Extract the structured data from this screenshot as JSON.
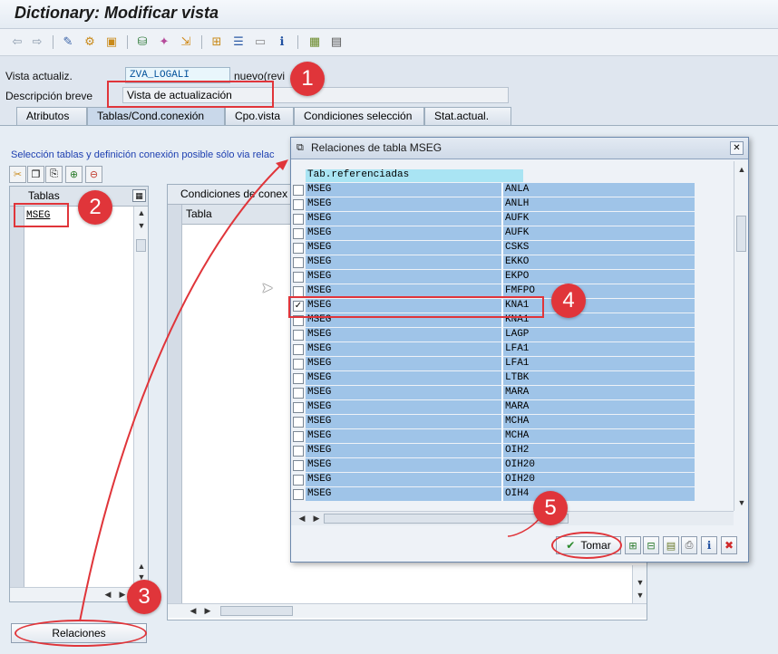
{
  "window": {
    "title": "Dictionary: Modificar vista"
  },
  "toolbar": {
    "icons": [
      "back-arrow-icon",
      "forward-arrow-icon",
      "edit-display-icon",
      "other-object-icon",
      "activate-icon",
      "check-icon",
      "magic-wand-icon",
      "where-used-icon",
      "hierarchy-icon",
      "menu-icon",
      "text-icon",
      "info-icon",
      "layout-icon",
      "grid-icon"
    ]
  },
  "header": {
    "vista_label": "Vista actualiz.",
    "vista_value": "ZVA_LOGALI",
    "vista_status": "nuevo(revi",
    "desc_label": "Descripción breve",
    "desc_value": "Vista de actualización"
  },
  "tabs": [
    {
      "label": "Atributos"
    },
    {
      "label": "Tablas/Cond.conexión"
    },
    {
      "label": "Cpo.vista"
    },
    {
      "label": "Condiciones selección"
    },
    {
      "label": "Stat.actual."
    }
  ],
  "main": {
    "info": "Selección tablas y definición conexión posible sólo via relac",
    "tables_header": "Tablas",
    "tables_row1": "MSEG",
    "conditions_header": "Condiciones de conex",
    "conditions_col": "Tabla",
    "relaciones_button": "Relaciones"
  },
  "dialog": {
    "title": "Relaciones de tabla MSEG",
    "column_header": "Tab.referenciadas",
    "rows": [
      {
        "left": "MSEG",
        "right": "ANLA",
        "checked": false
      },
      {
        "left": "MSEG",
        "right": "ANLH",
        "checked": false
      },
      {
        "left": "MSEG",
        "right": "AUFK",
        "checked": false
      },
      {
        "left": "MSEG",
        "right": "AUFK",
        "checked": false
      },
      {
        "left": "MSEG",
        "right": "CSKS",
        "checked": false
      },
      {
        "left": "MSEG",
        "right": "EKKO",
        "checked": false
      },
      {
        "left": "MSEG",
        "right": "EKPO",
        "checked": false
      },
      {
        "left": "MSEG",
        "right": "FMFPO",
        "checked": false
      },
      {
        "left": "MSEG",
        "right": "KNA1",
        "checked": true
      },
      {
        "left": "MSEG",
        "right": "KNA1",
        "checked": false
      },
      {
        "left": "MSEG",
        "right": "LAGP",
        "checked": false
      },
      {
        "left": "MSEG",
        "right": "LFA1",
        "checked": false
      },
      {
        "left": "MSEG",
        "right": "LFA1",
        "checked": false
      },
      {
        "left": "MSEG",
        "right": "LTBK",
        "checked": false
      },
      {
        "left": "MSEG",
        "right": "MARA",
        "checked": false
      },
      {
        "left": "MSEG",
        "right": "MARA",
        "checked": false
      },
      {
        "left": "MSEG",
        "right": "MCHA",
        "checked": false
      },
      {
        "left": "MSEG",
        "right": "MCHA",
        "checked": false
      },
      {
        "left": "MSEG",
        "right": "OIH2",
        "checked": false
      },
      {
        "left": "MSEG",
        "right": "OIH20",
        "checked": false
      },
      {
        "left": "MSEG",
        "right": "OIH20",
        "checked": false
      },
      {
        "left": "MSEG",
        "right": "OIH4",
        "checked": false
      }
    ],
    "tomar_button": "Tomar"
  },
  "callouts": [
    "1",
    "2",
    "3",
    "4",
    "5"
  ]
}
